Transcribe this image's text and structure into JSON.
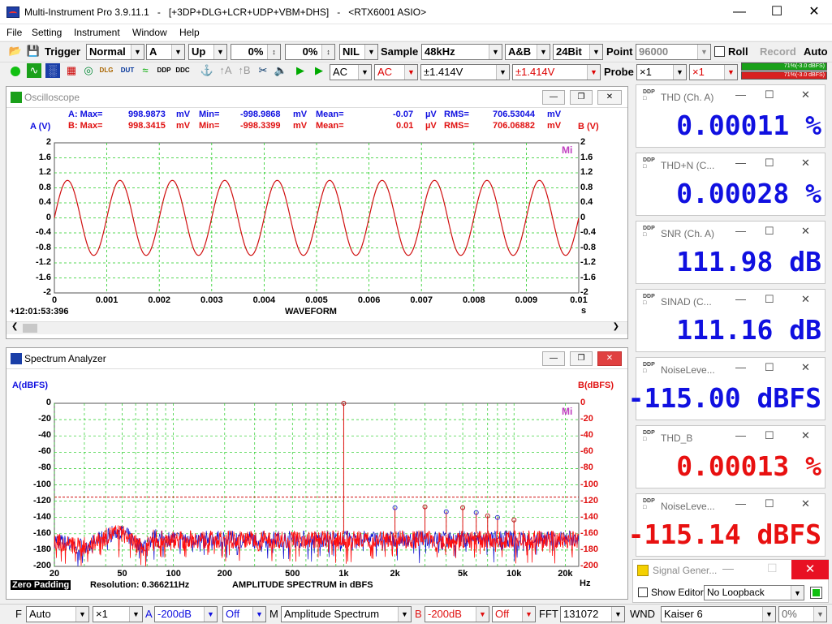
{
  "window": {
    "title": "Multi-Instrument Pro 3.9.11.1   -   [+3DP+DLG+LCR+UDP+VBM+DHS]   -   <RTX6001 ASIO>"
  },
  "menu": [
    "File",
    "Setting",
    "Instrument",
    "Window",
    "Help"
  ],
  "toolbar1": {
    "trigger_label": "Trigger",
    "trigger_mode": "Normal",
    "trigger_channel": "A",
    "trigger_edge": "Up",
    "trigger_level": "0%",
    "trigger_delay": "0%",
    "nil": "NIL",
    "sample_label": "Sample",
    "sample_rate": "48kHz",
    "channels": "A&B",
    "bits": "24Bit",
    "point_label": "Point",
    "points": "96000",
    "roll_label": "Roll",
    "record_label": "Record",
    "auto_label": "Auto"
  },
  "toolbar2": {
    "coupling_a": "AC",
    "coupling_b": "AC",
    "range_a": "±1.414V",
    "range_b": "±1.414V",
    "probe_label": "Probe",
    "probe_a": "×1",
    "probe_b": "×1",
    "meter_a": "71%(-3.0 dBFS)",
    "meter_b": "71%(-3.0 dBFS)"
  },
  "oscilloscope": {
    "title": "Oscilloscope",
    "statA": {
      "max_label": "A: Max=",
      "max": "998.9873",
      "u1": "mV",
      "min_label": "Min=",
      "min": "-998.9868",
      "u2": "mV",
      "mean_label": "Mean=",
      "mean": "-0.07",
      "u3": "µV",
      "rms_label": "RMS=",
      "rms": "706.53044",
      "u4": "mV"
    },
    "statB": {
      "max_label": "B: Max=",
      "max": "998.3415",
      "u1": "mV",
      "min_label": "Min=",
      "min": "-998.3399",
      "u2": "mV",
      "mean_label": "Mean=",
      "mean": "0.01",
      "u3": "µV",
      "rms_label": "RMS=",
      "rms": "706.06882",
      "u4": "mV"
    },
    "ylabel_left": "A (V)",
    "ylabel_right": "B (V)",
    "yticks": [
      "2",
      "1.6",
      "1.2",
      "0.8",
      "0.4",
      "0",
      "-0.4",
      "-0.8",
      "-1.2",
      "-1.6",
      "-2"
    ],
    "xticks": [
      "0",
      "0.001",
      "0.002",
      "0.003",
      "0.004",
      "0.005",
      "0.006",
      "0.007",
      "0.008",
      "0.009",
      "0.01"
    ],
    "xunit": "s",
    "xlabel": "WAVEFORM",
    "timestamp": "+12:01:53:396",
    "logo": "Mi"
  },
  "spectrum": {
    "title": "Spectrum Analyzer",
    "ylabel_left": "A(dBFS)",
    "ylabel_right": "B(dBFS)",
    "yticks": [
      "0",
      "-20",
      "-40",
      "-60",
      "-80",
      "-100",
      "-120",
      "-140",
      "-160",
      "-180",
      "-200"
    ],
    "xticks": [
      "20",
      "50",
      "100",
      "200",
      "500",
      "1k",
      "2k",
      "5k",
      "10k",
      "20k"
    ],
    "xunit": "Hz",
    "zero_padding": "Zero Padding",
    "resolution": "Resolution: 0.366211Hz",
    "xlabel": "AMPLITUDE  SPECTRUM in dBFS",
    "logo": "Mi"
  },
  "meters": [
    {
      "title": "THD (Ch. A)",
      "value": "0.00011  %",
      "color": "#1010e0"
    },
    {
      "title": "THD+N (C...",
      "value": "0.00028  %",
      "color": "#1010e0"
    },
    {
      "title": "SNR (Ch. A)",
      "value": "111.98 dB",
      "color": "#1010e0"
    },
    {
      "title": "SINAD (C...",
      "value": "111.16 dB",
      "color": "#1010e0"
    },
    {
      "title": "NoiseLeve...",
      "value": "-115.00 dBFS",
      "color": "#1010e0"
    },
    {
      "title": "THD_B",
      "value": "0.00013  %",
      "color": "#e81010"
    },
    {
      "title": "NoiseLeve...",
      "value": "-115.14 dBFS",
      "color": "#e81010"
    }
  ],
  "signal_gen": {
    "title": "Signal Gener...",
    "show_editor": "Show Editor",
    "loopback": "No Loopback"
  },
  "bottom": {
    "f_label": "F",
    "f_mode": "Auto",
    "f_mult": "×1",
    "a_label": "A",
    "a_floor": "-200dB",
    "a_off": "Off",
    "m_label": "M",
    "mode": "Amplitude Spectrum",
    "b_label": "B",
    "b_floor": "-200dB",
    "b_off": "Off",
    "fft_label": "FFT",
    "fft_size": "131072",
    "wnd_label": "WND",
    "window": "Kaiser 6",
    "overlap": "0%"
  },
  "chart_data": [
    {
      "type": "line",
      "title": "WAVEFORM",
      "xlabel": "s",
      "ylabel": "A (V)",
      "xlim": [
        0,
        0.01
      ],
      "ylim": [
        -2,
        2
      ],
      "series": [
        {
          "name": "A",
          "description": "1 kHz sine, amplitude 0.999 V",
          "x": [
            0,
            0.00025,
            0.0005,
            0.00075,
            0.001
          ],
          "values": [
            0,
            1,
            0,
            -1,
            0
          ]
        }
      ]
    },
    {
      "type": "line",
      "title": "AMPLITUDE  SPECTRUM in dBFS",
      "xlabel": "Hz",
      "ylabel": "A(dBFS)",
      "xscale": "log",
      "xlim": [
        20,
        24000
      ],
      "ylim": [
        -200,
        0
      ],
      "noise_threshold_dbfs": -115,
      "peaks": [
        {
          "freq": 1000,
          "dbfs": 0
        },
        {
          "freq": 2000,
          "dbfs": -128
        },
        {
          "freq": 3000,
          "dbfs": -127
        },
        {
          "freq": 4000,
          "dbfs": -133
        },
        {
          "freq": 5000,
          "dbfs": -128
        },
        {
          "freq": 6000,
          "dbfs": -134
        },
        {
          "freq": 7000,
          "dbfs": -138
        },
        {
          "freq": 8000,
          "dbfs": -140
        },
        {
          "freq": 10000,
          "dbfs": -143
        }
      ]
    }
  ]
}
